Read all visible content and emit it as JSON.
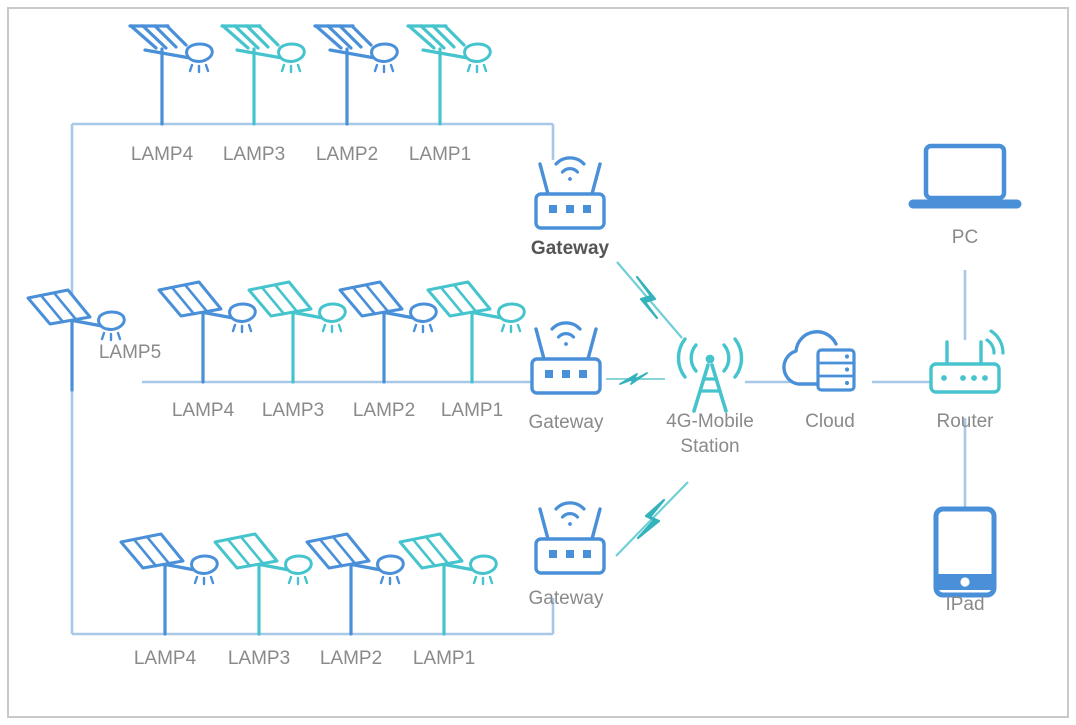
{
  "figure": {
    "kind": "network-topology-diagram",
    "subject": "Solar street lamp IoT remote control network",
    "border_color": "#c9c9c9",
    "background": "#ffffff"
  },
  "palette": {
    "blue": "#4a90d9",
    "blue_dark": "#3f7fc4",
    "teal": "#45c4cd",
    "teal_dark": "#35b3bd",
    "line": "#a8c8e8",
    "label_gray": "#8a8a8a",
    "label_dark": "#555555"
  },
  "groups": {
    "top_row": {
      "name": "top-lamp-group",
      "lamp_style": "pole-lamp",
      "lamps": [
        {
          "label": "LAMP4",
          "color": "#4a90d9"
        },
        {
          "label": "LAMP3",
          "color": "#45c4cd"
        },
        {
          "label": "LAMP2",
          "color": "#4a90d9"
        },
        {
          "label": "LAMP1",
          "color": "#45c4cd"
        }
      ]
    },
    "middle_row": {
      "name": "middle-lamp-group",
      "lamp_style": "solar-panel-lamp",
      "standalone": {
        "label": "LAMP5",
        "color": "#4a90d9"
      },
      "lamps": [
        {
          "label": "LAMP4",
          "color": "#4a90d9"
        },
        {
          "label": "LAMP3",
          "color": "#45c4cd"
        },
        {
          "label": "LAMP2",
          "color": "#4a90d9"
        },
        {
          "label": "LAMP1",
          "color": "#45c4cd"
        }
      ]
    },
    "bottom_row": {
      "name": "bottom-lamp-group",
      "lamp_style": "solar-panel-lamp",
      "lamps": [
        {
          "label": "LAMP4",
          "color": "#4a90d9"
        },
        {
          "label": "LAMP3",
          "color": "#45c4cd"
        },
        {
          "label": "LAMP2",
          "color": "#4a90d9"
        },
        {
          "label": "LAMP1",
          "color": "#45c4cd"
        }
      ]
    }
  },
  "nodes": {
    "gateway_top": {
      "label": "Gateway",
      "icon": "wifi-router-icon",
      "color": "#4a90d9",
      "bold": true
    },
    "gateway_middle": {
      "label": "Gateway",
      "icon": "wifi-router-icon",
      "color": "#4a90d9",
      "bold": false
    },
    "gateway_bottom": {
      "label": "Gateway",
      "icon": "wifi-router-icon",
      "color": "#4a90d9",
      "bold": false
    },
    "mobile_station": {
      "label_line1": "4G-Mobile",
      "label_line2": "Station",
      "icon": "cell-tower-icon",
      "color": "#45c4cd"
    },
    "cloud": {
      "label": "Cloud",
      "icon": "cloud-server-icon",
      "color": "#4a90d9"
    },
    "router": {
      "label": "Router",
      "icon": "wifi-router-icon",
      "color": "#45c4cd"
    },
    "pc": {
      "label": "PC",
      "icon": "laptop-icon",
      "color": "#4a90d9"
    },
    "ipad": {
      "label": "IPad",
      "icon": "tablet-icon",
      "color": "#4a90d9"
    }
  },
  "links": [
    {
      "from": "top_row_bus",
      "to": "gateway_top",
      "style": "solid"
    },
    {
      "from": "middle_row_bus",
      "to": "gateway_middle",
      "style": "solid"
    },
    {
      "from": "bottom_row_bus",
      "to": "gateway_bottom",
      "style": "solid"
    },
    {
      "from": "gateway_top",
      "to": "mobile_station",
      "style": "wireless-bolt"
    },
    {
      "from": "gateway_middle",
      "to": "mobile_station",
      "style": "wireless-bolt"
    },
    {
      "from": "gateway_bottom",
      "to": "mobile_station",
      "style": "wireless-bolt"
    },
    {
      "from": "mobile_station",
      "to": "cloud",
      "style": "solid"
    },
    {
      "from": "cloud",
      "to": "router",
      "style": "solid"
    },
    {
      "from": "router",
      "to": "pc",
      "style": "solid"
    },
    {
      "from": "router",
      "to": "ipad",
      "style": "solid"
    }
  ]
}
